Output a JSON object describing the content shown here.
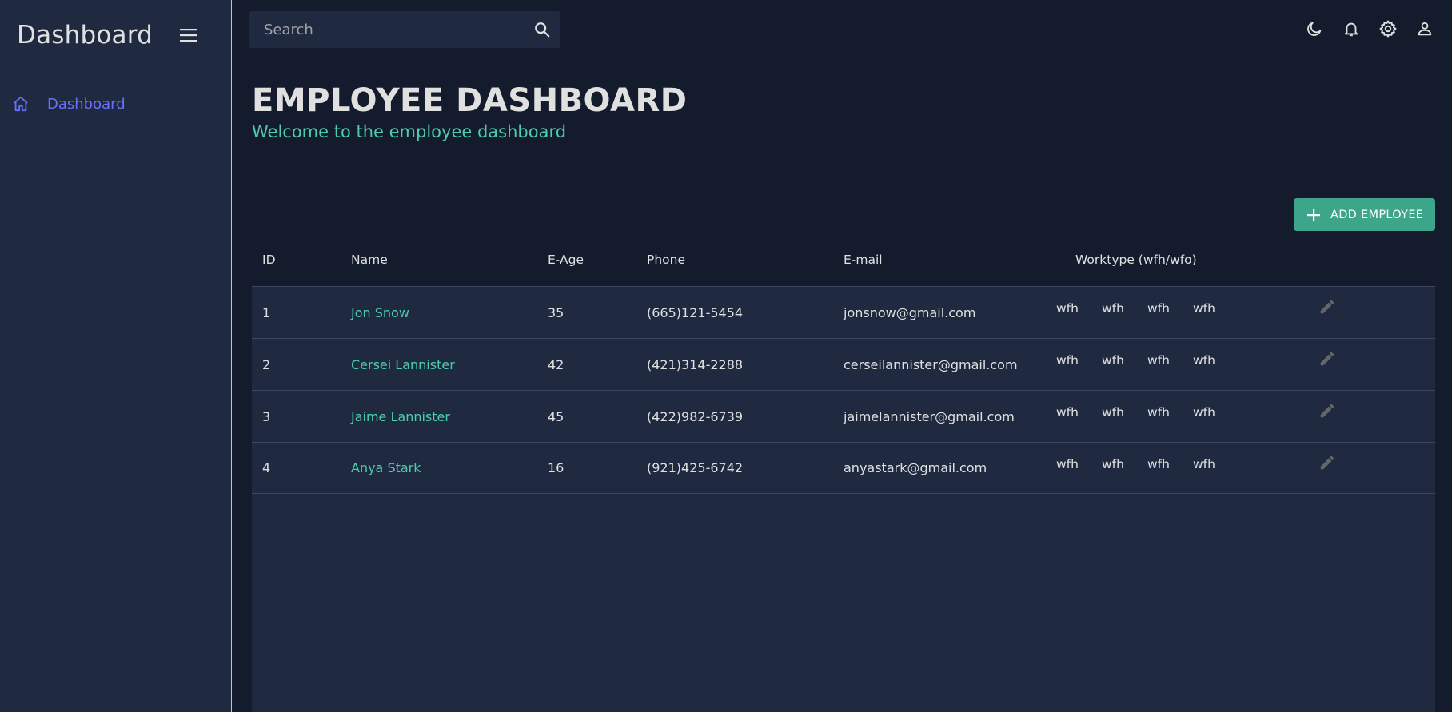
{
  "sidebar": {
    "title": "Dashboard",
    "items": [
      {
        "label": "Dashboard",
        "icon": "home-icon",
        "active": true
      }
    ]
  },
  "topbar": {
    "search_placeholder": "Search",
    "icons": [
      "moon-icon",
      "bell-icon",
      "gear-icon",
      "person-icon"
    ]
  },
  "header": {
    "title": "EMPLOYEE DASHBOARD",
    "subtitle": "Welcome to the employee dashboard"
  },
  "actions": {
    "add_employee_label": "ADD EMPLOYEE"
  },
  "table": {
    "columns": {
      "id": "ID",
      "name": "Name",
      "age": "E-Age",
      "phone": "Phone",
      "email": "E-mail",
      "worktype": "Worktype (wfh/wfo)"
    },
    "rows": [
      {
        "id": "1",
        "name": "Jon Snow",
        "age": "35",
        "phone": "(665)121-5454",
        "email": "jonsnow@gmail.com",
        "worktype": [
          "wfh",
          "wfh",
          "wfh",
          "wfh"
        ]
      },
      {
        "id": "2",
        "name": "Cersei Lannister",
        "age": "42",
        "phone": "(421)314-2288",
        "email": "cerseilannister@gmail.com",
        "worktype": [
          "wfh",
          "wfh",
          "wfh",
          "wfh"
        ]
      },
      {
        "id": "3",
        "name": "Jaime Lannister",
        "age": "45",
        "phone": "(422)982-6739",
        "email": "jaimelannister@gmail.com",
        "worktype": [
          "wfh",
          "wfh",
          "wfh",
          "wfh"
        ]
      },
      {
        "id": "4",
        "name": "Anya Stark",
        "age": "16",
        "phone": "(921)425-6742",
        "email": "anyastark@gmail.com",
        "worktype": [
          "wfh",
          "wfh",
          "wfh",
          "wfh"
        ]
      }
    ]
  },
  "colors": {
    "background": "#141b2d",
    "panel": "#1f2a40",
    "accent_green": "#4cceac",
    "button_green": "#3da58a",
    "nav_active": "#6870fa"
  }
}
